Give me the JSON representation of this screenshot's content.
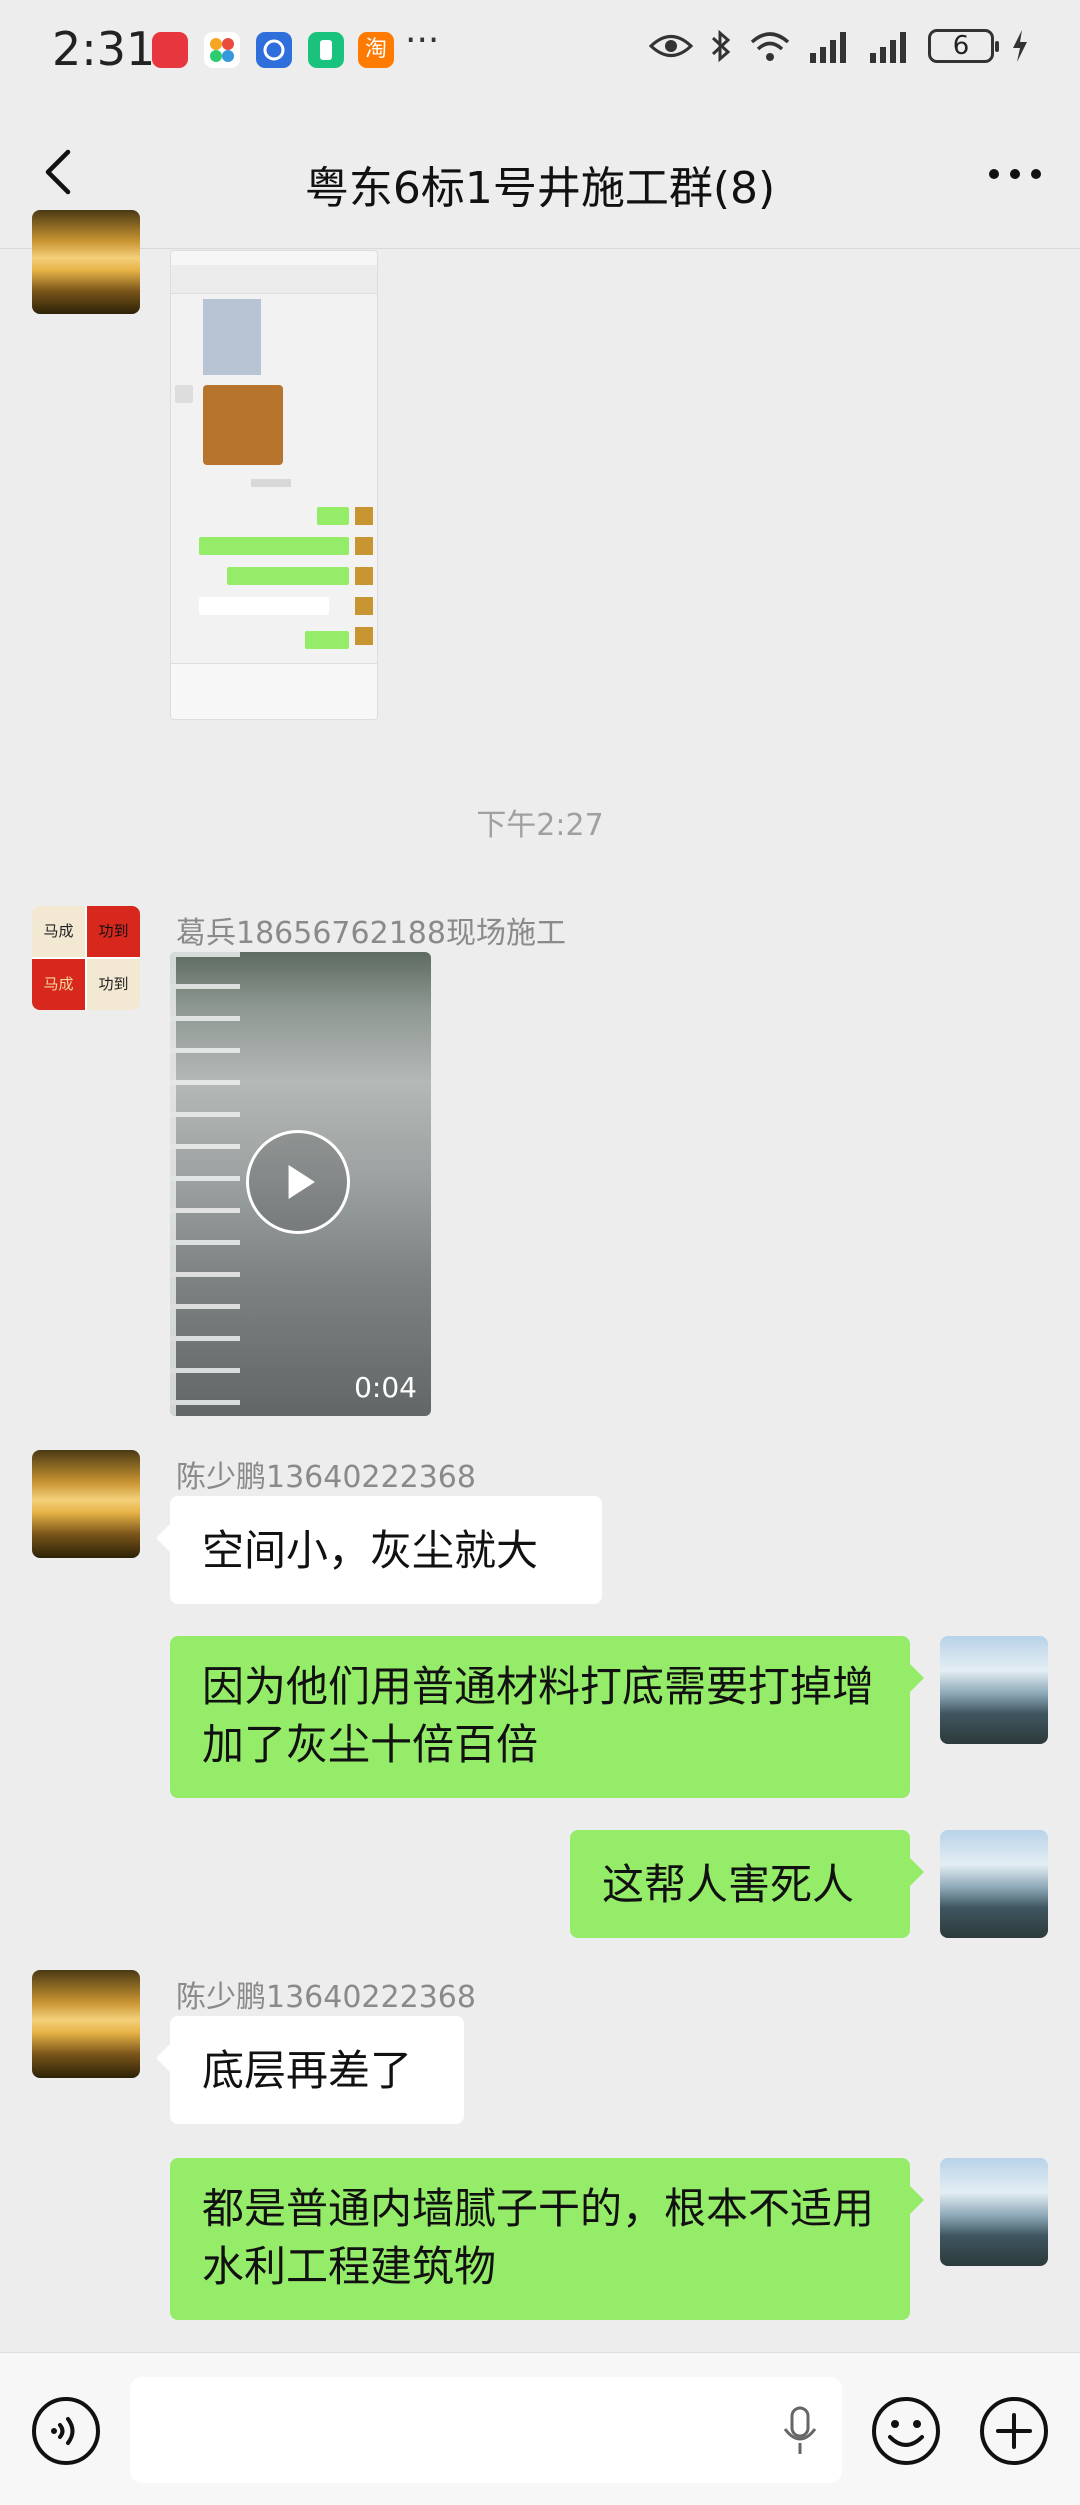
{
  "status_bar": {
    "time": "2:31",
    "notification_icons": [
      "huawei-store-icon",
      "pinwheel-app-icon",
      "blue-app-icon",
      "green-app-icon",
      "taobao-icon"
    ],
    "more": "···",
    "battery": "6"
  },
  "header": {
    "title": "粤东6标1号井施工群(8)"
  },
  "messages": {
    "timestamp": "下午2:27",
    "video": {
      "sender": "葛兵18656762188现场施工",
      "duration": "0:04"
    },
    "m1": {
      "sender": "陈少鹏13640222368",
      "text": "空间小，灰尘就大"
    },
    "m2": {
      "text": "因为他们用普通材料打底需要打掉增加了灰尘十倍百倍"
    },
    "m3": {
      "text": "这帮人害死人"
    },
    "m4": {
      "sender": "陈少鹏13640222368",
      "text": "底层再差了"
    },
    "m5": {
      "text": "都是普通内墙腻子干的，根本不适用水利工程建筑物"
    }
  },
  "avatar_text": [
    "马成",
    "功到",
    "马成",
    "功到"
  ],
  "colors": {
    "background": "#ededed",
    "bubble_self": "#95ec69",
    "bubble_other": "#ffffff",
    "meta_text": "#8a8a8a"
  }
}
